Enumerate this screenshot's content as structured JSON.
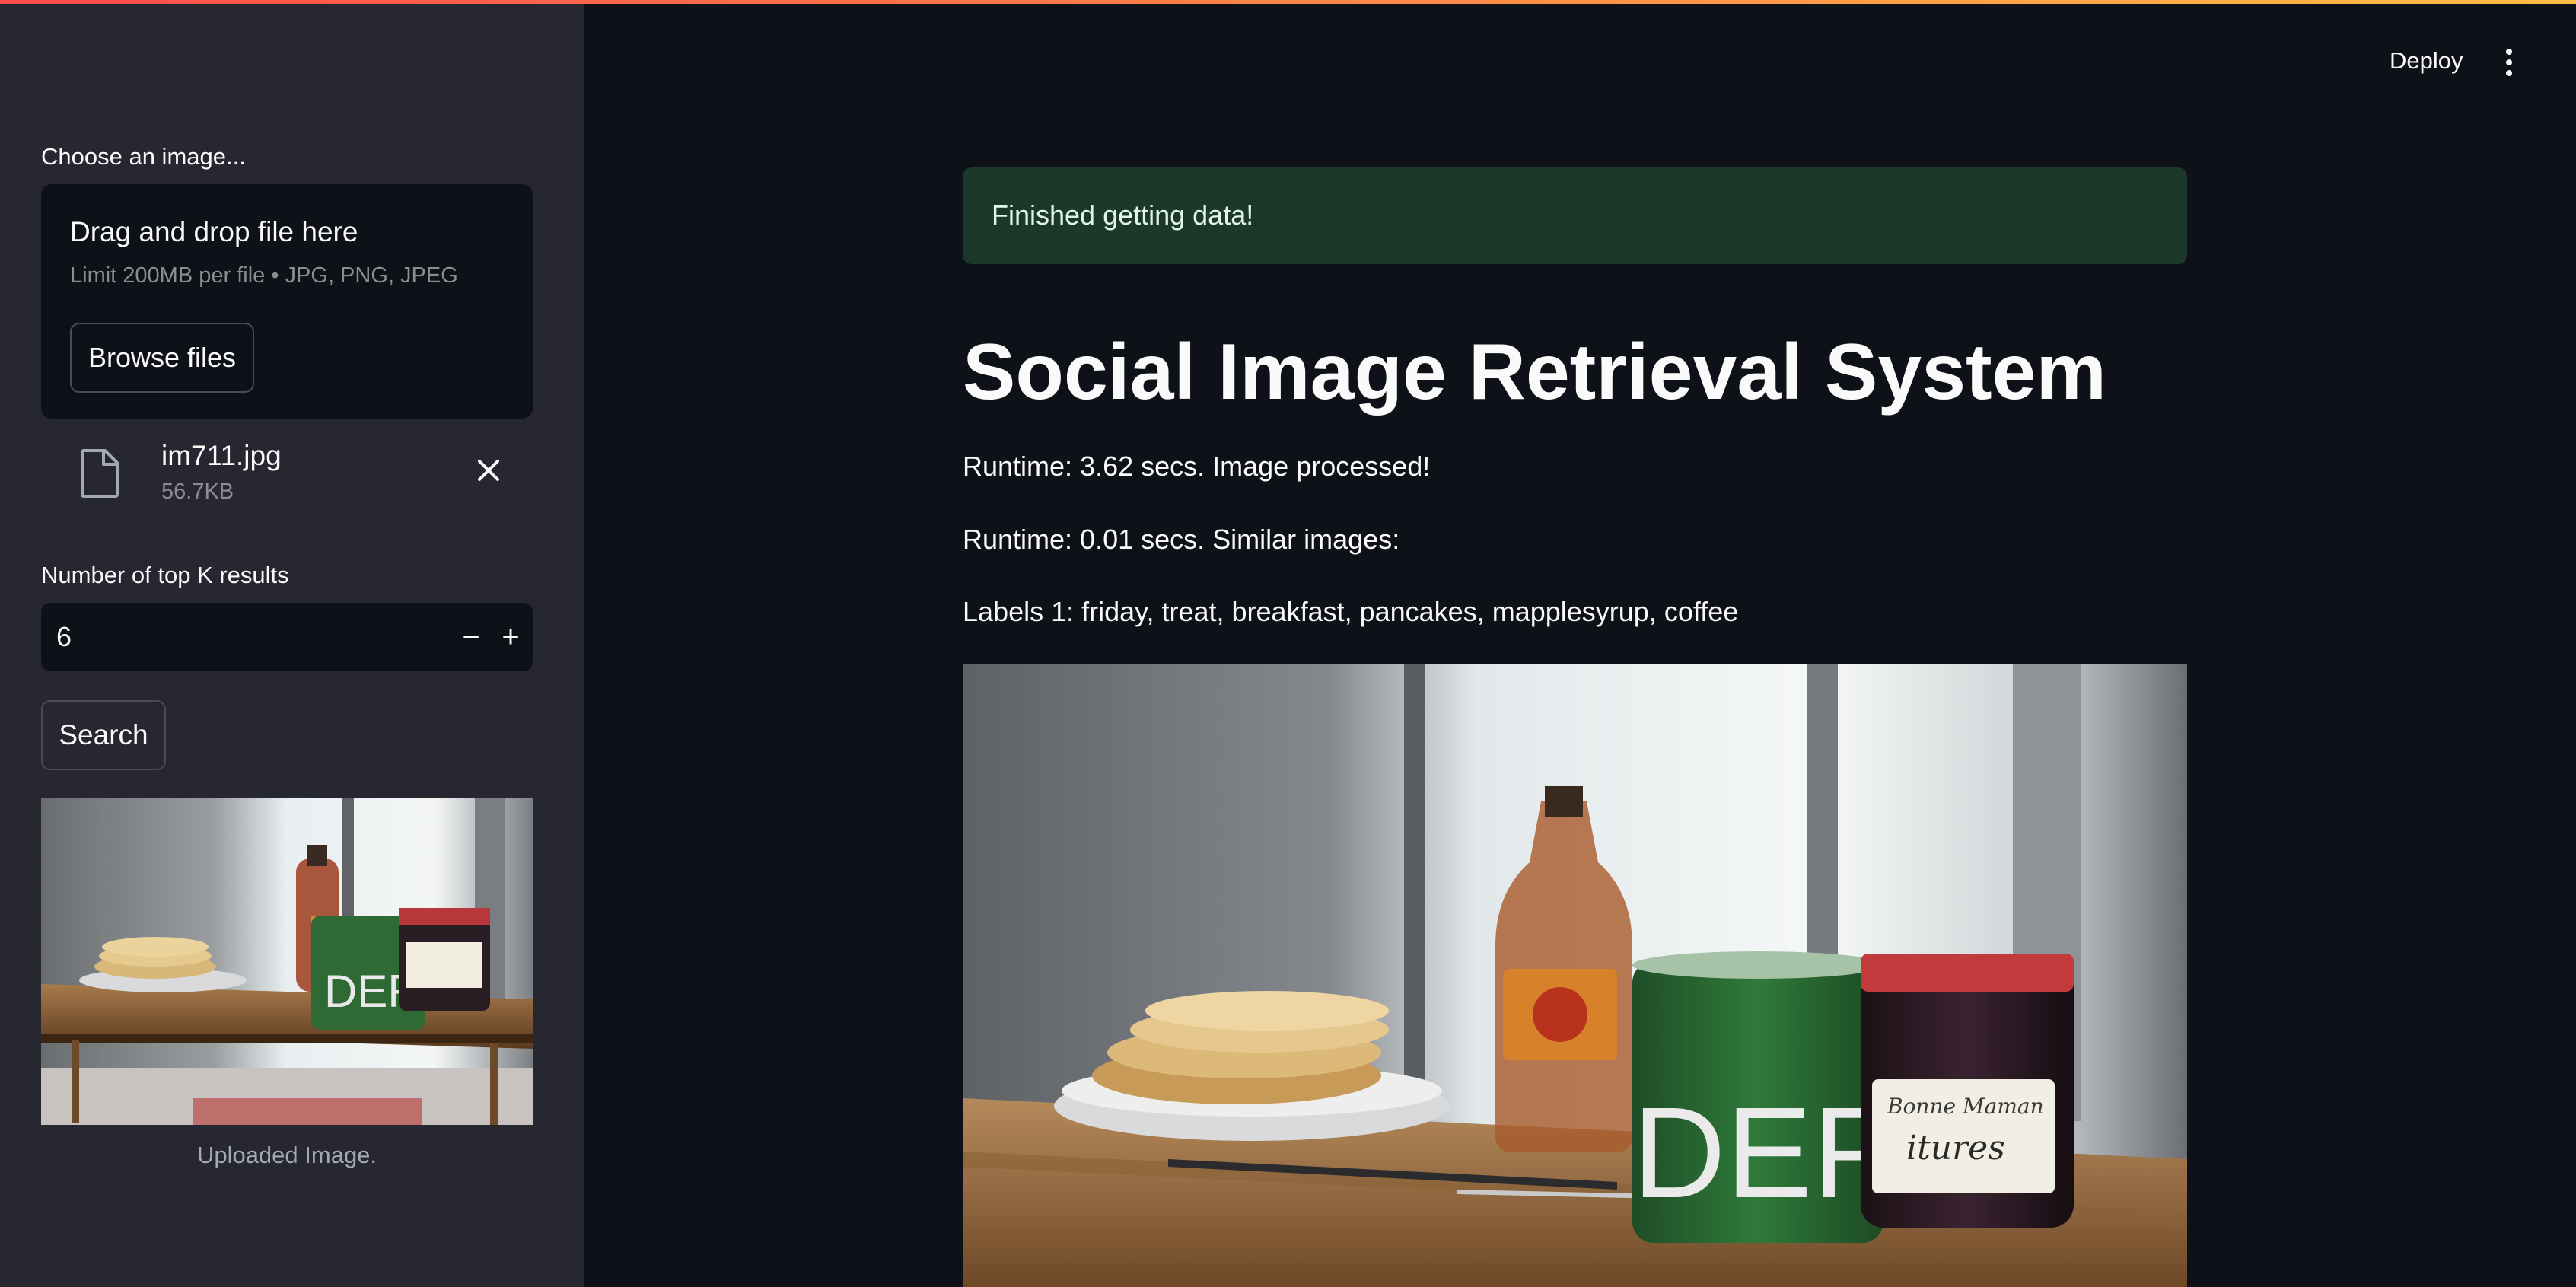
{
  "header": {
    "deploy_label": "Deploy",
    "menu_icon": "kebab-menu-icon",
    "accent_gradient": [
      "#ff4b4b",
      "#ffbd45"
    ]
  },
  "sidebar": {
    "upload": {
      "label": "Choose an image...",
      "dropzone_title": "Drag and drop file here",
      "dropzone_limit": "Limit 200MB per file • JPG, PNG, JPEG",
      "browse_label": "Browse files",
      "file": {
        "name": "im711.jpg",
        "size": "56.7KB",
        "icon": "file-icon",
        "remove_icon": "close-icon"
      }
    },
    "topk": {
      "label": "Number of top K results",
      "value": "6",
      "minus": "−",
      "plus": "+"
    },
    "search_label": "Search",
    "thumbnail_caption": "Uploaded Image."
  },
  "main": {
    "alert": {
      "text": "Finished getting data!",
      "color": "#1c3829"
    },
    "title": "Social Image Retrieval System",
    "lines": [
      "Runtime: 3.62 secs. Image processed!",
      "Runtime: 0.01 secs. Similar images:",
      "Labels 1: friday, treat, breakfast, pancakes, mapplesyrup, coffee"
    ]
  }
}
